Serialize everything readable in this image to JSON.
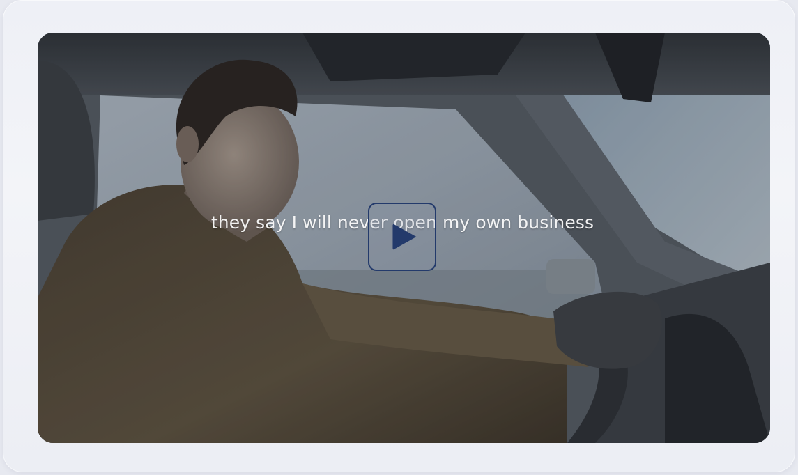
{
  "player": {
    "caption": "they say I will never open my own business",
    "play_icon": "play-icon"
  },
  "colors": {
    "play_accent": "#233a6b",
    "card_background": "#eef0f6"
  }
}
